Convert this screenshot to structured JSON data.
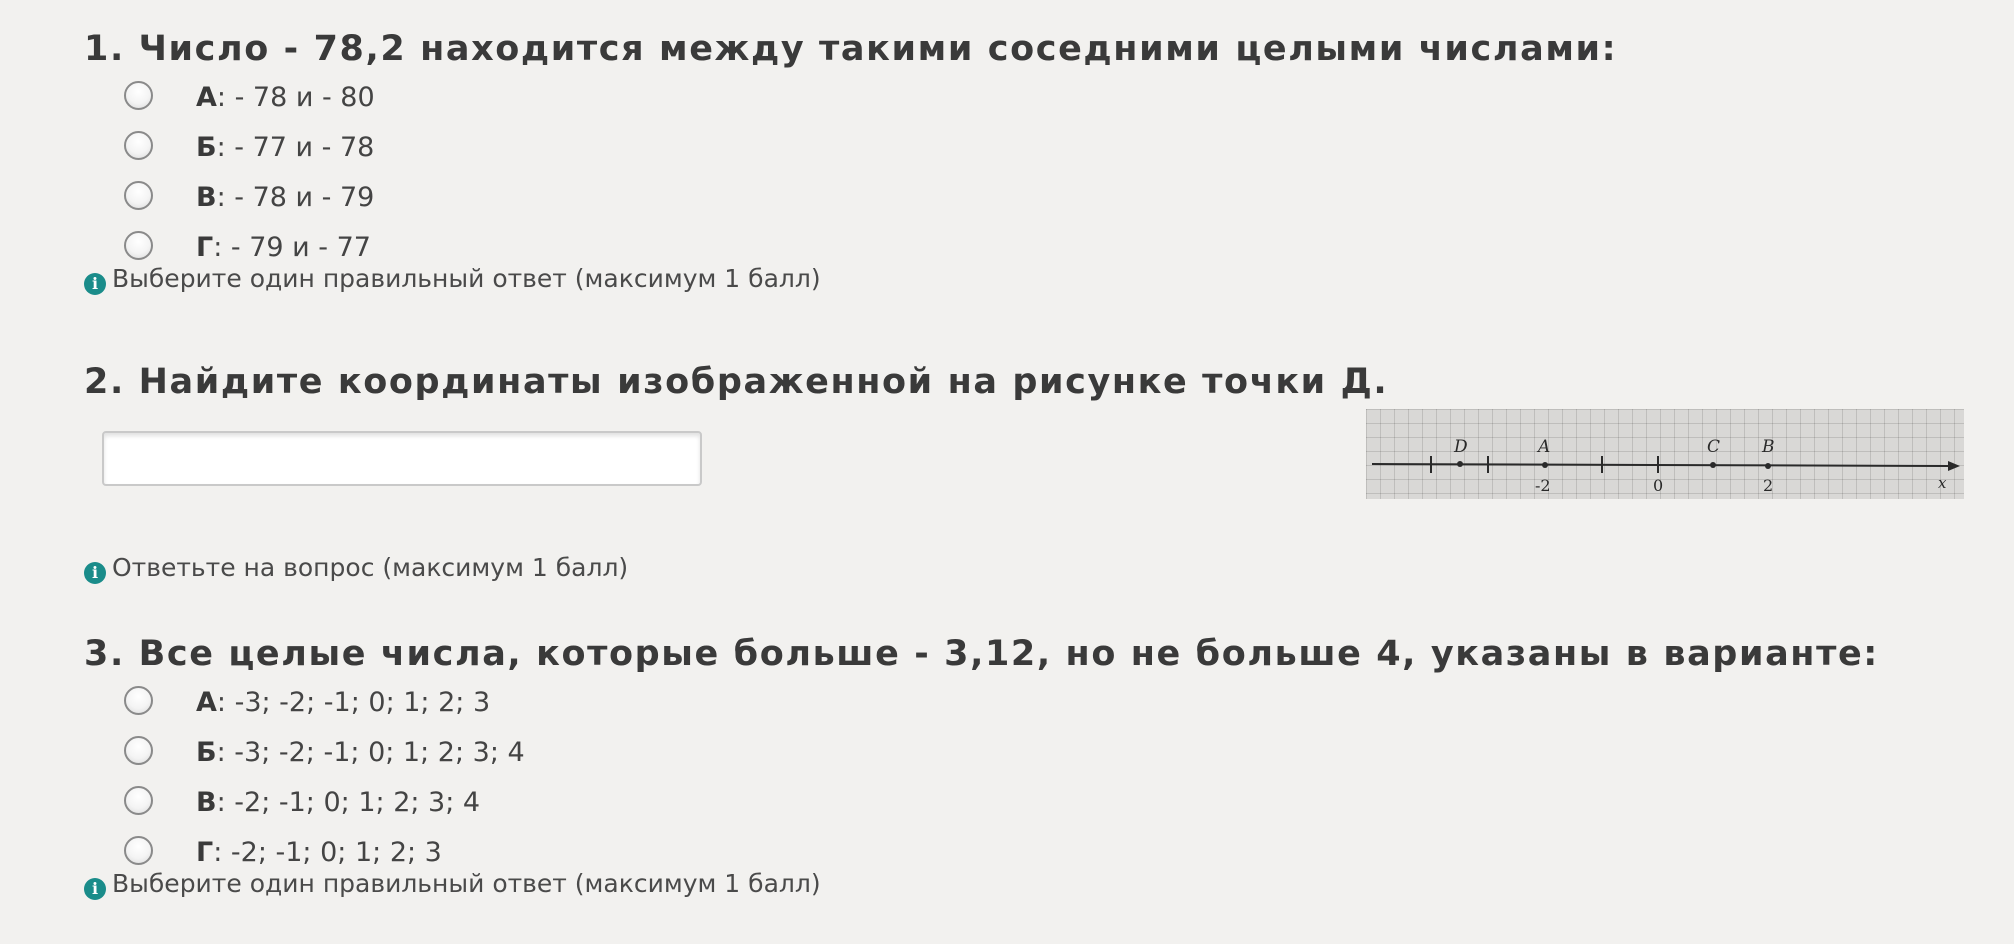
{
  "q1": {
    "title": "1. Число - 78,2 находится между такими соседними целыми числами:",
    "options": [
      {
        "letter": "А",
        "text": ": - 78 и - 80"
      },
      {
        "letter": "Б",
        "text": ": - 77 и - 78"
      },
      {
        "letter": "В",
        "text": ": - 78 и - 79"
      },
      {
        "letter": "Г",
        "text": ": - 79 и - 77"
      }
    ],
    "hint": "Выберите один правильный ответ (максимум 1 балл)"
  },
  "q2": {
    "title": "2. Найдите координаты изображенной на рисунке точки Д.",
    "answer_value": "",
    "hint": "Ответьте на вопрос (максимум 1 балл)",
    "figure": {
      "point_labels": [
        "D",
        "A",
        "C",
        "B"
      ],
      "tick_labels": [
        "-2",
        "0",
        "2"
      ],
      "axis_label": "x"
    }
  },
  "q3": {
    "title": "3. Все целые числа, которые больше - 3,12, но не больше 4, указаны в варианте:",
    "options": [
      {
        "letter": "А",
        "text": ": -3; -2; -1; 0; 1; 2; 3"
      },
      {
        "letter": "Б",
        "text": ": -3; -2; -1; 0; 1; 2; 3; 4"
      },
      {
        "letter": "В",
        "text": ": -2; -1; 0; 1; 2; 3; 4"
      },
      {
        "letter": "Г",
        "text": ": -2; -1; 0; 1; 2; 3"
      }
    ],
    "hint": "Выберите один правильный ответ (максимум 1 балл)"
  },
  "colors": {
    "background": "#f2f1ef",
    "info_icon": "#1a8c8a",
    "text": "#3a3a3a"
  },
  "icons": {
    "hint_icon": "info-icon",
    "radio": "radio-button"
  }
}
